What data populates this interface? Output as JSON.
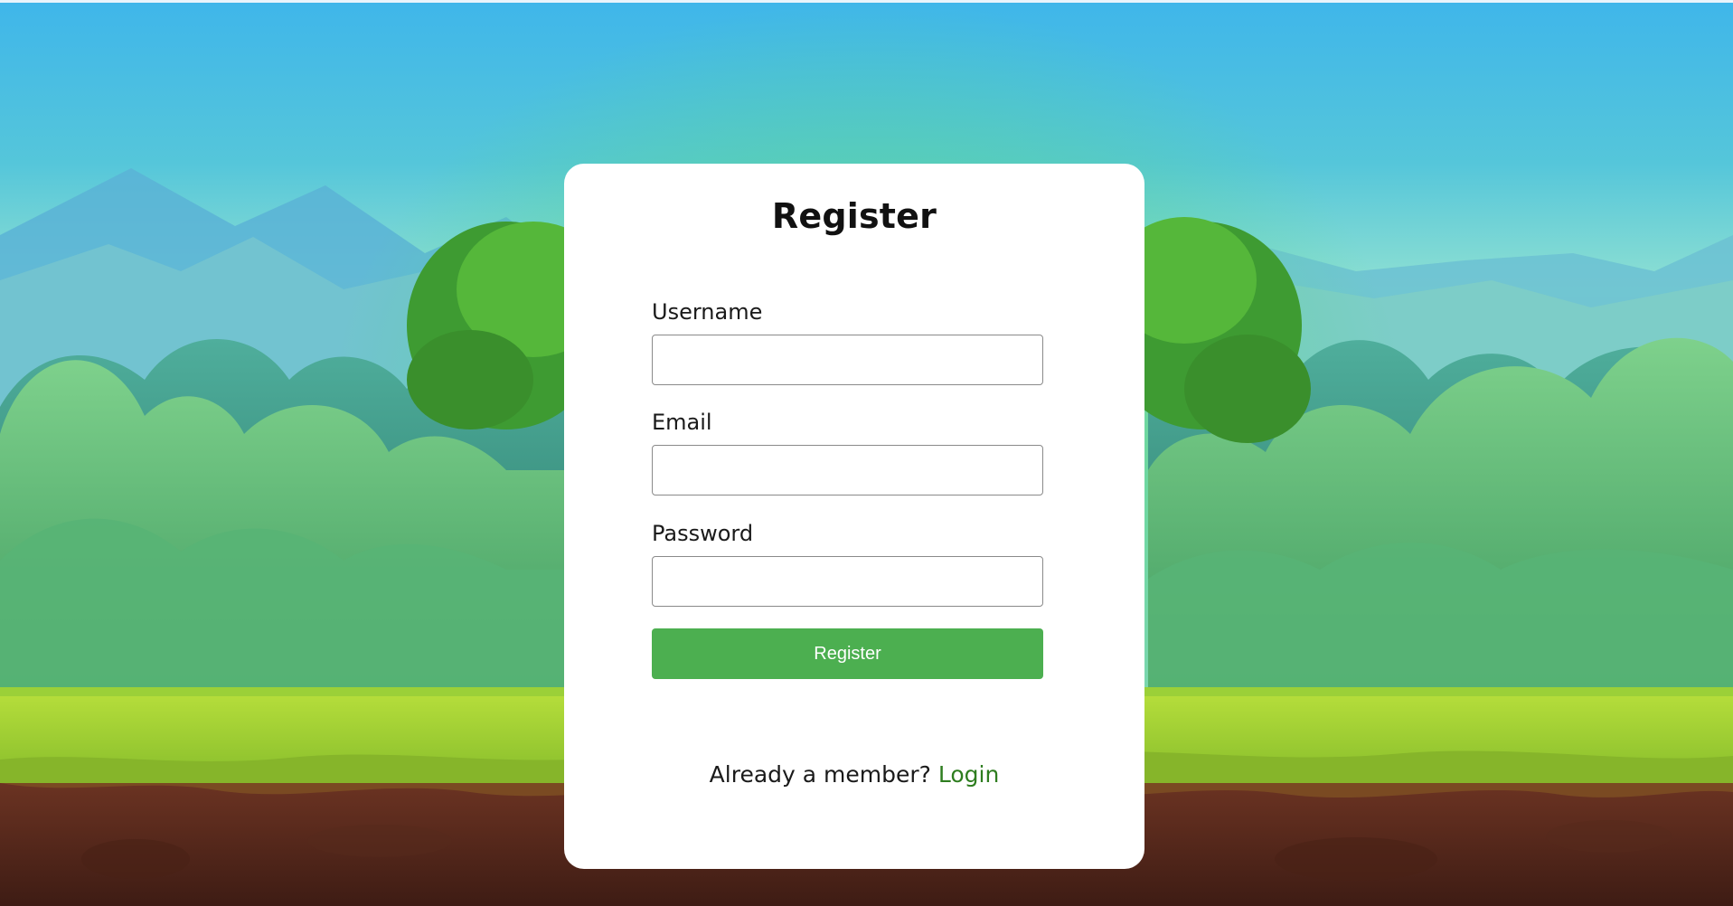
{
  "form": {
    "title": "Register",
    "username_label": "Username",
    "username_value": "",
    "email_label": "Email",
    "email_value": "",
    "password_label": "Password",
    "password_value": "",
    "submit_label": "Register",
    "footer_text": "Already a member?",
    "login_link": "Login"
  },
  "colors": {
    "button": "#4caf50",
    "link": "#2e7d1f",
    "card": "#ffffff",
    "sky_top": "#3fb6ea",
    "grass": "#a8d63a",
    "soil": "#5a2a1e"
  },
  "background": {
    "icon": "forest-landscape-illustration"
  }
}
